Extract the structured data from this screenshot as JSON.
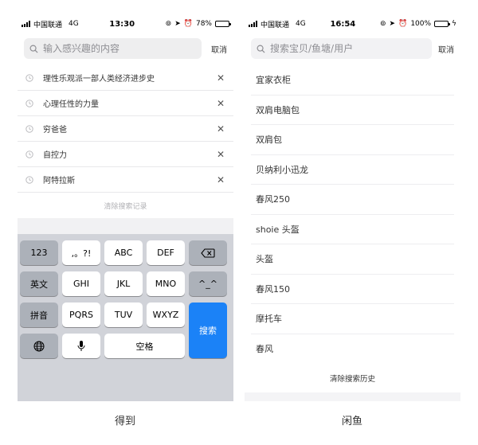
{
  "left_phone": {
    "status": {
      "carrier": "中国联通",
      "network": "4G",
      "time": "13:30",
      "battery": "78%",
      "battery_level": 0.78
    },
    "search": {
      "placeholder": "输入感兴趣的内容",
      "cancel_label": "取消"
    },
    "history": [
      "理性乐观派一部人类经济进步史",
      "心理任性的力量",
      "穷爸爸",
      "自控力",
      "阿特拉斯"
    ],
    "clear_label": "清除搜索记录",
    "keyboard": {
      "row1": [
        "123",
        ",。?!",
        "ABC",
        "DEF"
      ],
      "row2": [
        "英文",
        "GHI",
        "JKL",
        "MNO",
        "^_^"
      ],
      "row3": [
        "拼音",
        "PQRS",
        "TUV",
        "WXYZ"
      ],
      "row4_space": "空格",
      "search_key": "搜索"
    },
    "caption": "得到"
  },
  "right_phone": {
    "status": {
      "carrier": "中国联通",
      "network": "4G",
      "time": "16:54",
      "battery": "100%",
      "battery_level": 1.0
    },
    "search": {
      "placeholder": "搜索宝贝/鱼塘/用户",
      "cancel_label": "取消"
    },
    "history": [
      "宜家衣柜",
      "双肩电脑包",
      "双肩包",
      "贝纳利小迅龙",
      "春风250",
      "shoie 头盔",
      "头盔",
      "春风150",
      "摩托车",
      "春风"
    ],
    "clear_label": "清除搜索历史",
    "caption": "闲鱼"
  },
  "colors": {
    "search_key": "#1b82f7",
    "keyboard_bg": "#d1d3d9",
    "gray_key": "#acb1b9",
    "battery_green": "#4cd964"
  }
}
